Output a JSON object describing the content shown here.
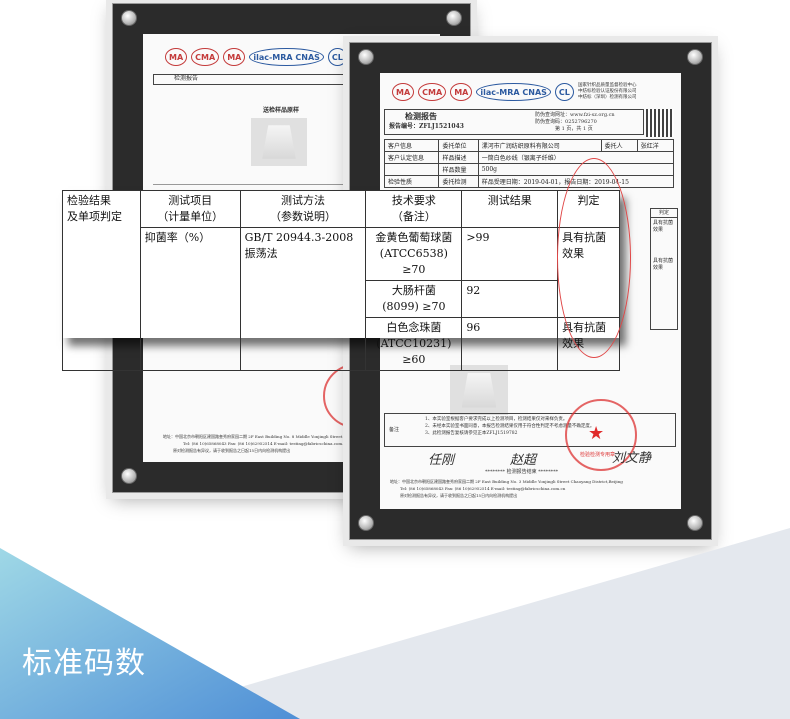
{
  "back_certificate": {
    "logos": [
      "MA",
      "CMA",
      "MA",
      "ilac-MRA CNAS",
      "CL",
      "~"
    ],
    "row_label": "检测报告",
    "sample_title": "送检样品原样",
    "address": "地址：中国北京市朝阳区建国路奎秀府家园二期 2F East Building No. 8 Middle Yonjingli Street",
    "contact": "Tel: (86 10)65868043   Fax: (86 10)62952514   E-mail: testing@fabricschina.com.cn",
    "note": "原对检测报告有异议，请于收到报告之日起15日内向检测机构提出"
  },
  "front_certificate": {
    "logos": [
      "MA",
      "CMA",
      "MA",
      "ilac-MRA CNAS",
      "CL"
    ],
    "org_name": [
      "国家针织品质量监督检验中心",
      "中纺标检验认证股份有限公司",
      "中纺标（深圳）检测有限公司"
    ],
    "report_title": "检测报告",
    "report_no_label": "报告编号：",
    "report_no": "ZFLJ1521043",
    "query_label": "防伪查询网址：",
    "query_url": "www.fzi-sz.org.cn",
    "code_label": "防伪查询码：",
    "code": "0252796270",
    "page_text": "第 1 页，共 1 页",
    "client_rows": [
      [
        "客户信息",
        "委托单位",
        "漯河市广润纺织原料有限公司",
        "委托人",
        "张红洋"
      ],
      [
        "客户认定信息",
        "样品描述",
        "一筒白色纱线（银离子纤维）",
        "",
        ""
      ],
      [
        "",
        "样品数量",
        "500g",
        "",
        ""
      ],
      [
        "检验性质",
        "委托检测",
        "样品受理日期：2019-04-01，报告日期：2019-04-15",
        "",
        ""
      ]
    ],
    "side_cells": [
      "判定",
      "具有抗菌效果",
      "具有抗菌效果"
    ],
    "remarks_label": "备注",
    "remarks": [
      "1、本实验室根据客户要求完成以上检测项目，检测结果仅对来样负责。",
      "2、未经本实验室书面同意，本报告检测结果仅用于符合性判定不考虑测量不确定度。",
      "3、此检测报告复核请参见正本ZFLJ1519782"
    ],
    "signatures": [
      "任刚",
      "赵超",
      "刘文静"
    ],
    "end_text": "******** 检测报告结束 ********",
    "stamp_text": "检验检测专用章",
    "address": "地址：中国北京市朝阳区建国路奎秀府家园二期 2F East Building No. 3 Middle Yonjingli Street Chaoyang District,Beijing",
    "contact": "Tel: (86 10)65868043   Fax: (86 10)62952514   E-mail: testing@fabricschina.com.cn",
    "note": "原对检测报告有异议，请于收到报告之日起15日内向检测机构提出"
  },
  "zoom_table": {
    "row_header": [
      "检验结果",
      "及单项判定"
    ],
    "headers": {
      "item": [
        "测试项目",
        "（计量单位）"
      ],
      "method": [
        "测试方法",
        "（参数说明）"
      ],
      "requirement": [
        "技术要求",
        "（备注）"
      ],
      "result": "测试结果",
      "verdict": "判定"
    },
    "item": "抑菌率（%）",
    "method": "GB/T 20944.3-2008 振荡法",
    "rows": [
      {
        "requirement": [
          "金黄色葡萄球菌",
          "(ATCC6538) ≥70"
        ],
        "result": ">99"
      },
      {
        "requirement": [
          "大肠杆菌",
          "(8099) ≥70"
        ],
        "result": "92"
      },
      {
        "requirement": [
          "白色念珠菌",
          "(ATCC10231) ≥60"
        ],
        "result": "96"
      }
    ],
    "verdicts": [
      "具有抗菌效果",
      "具有抗菌效果"
    ]
  },
  "banner": {
    "title": "标准码数",
    "colors": {
      "band_light": "#e4e8ee",
      "band_blue": "#4f8fd6",
      "band_teal": "#9fd8e6"
    }
  }
}
